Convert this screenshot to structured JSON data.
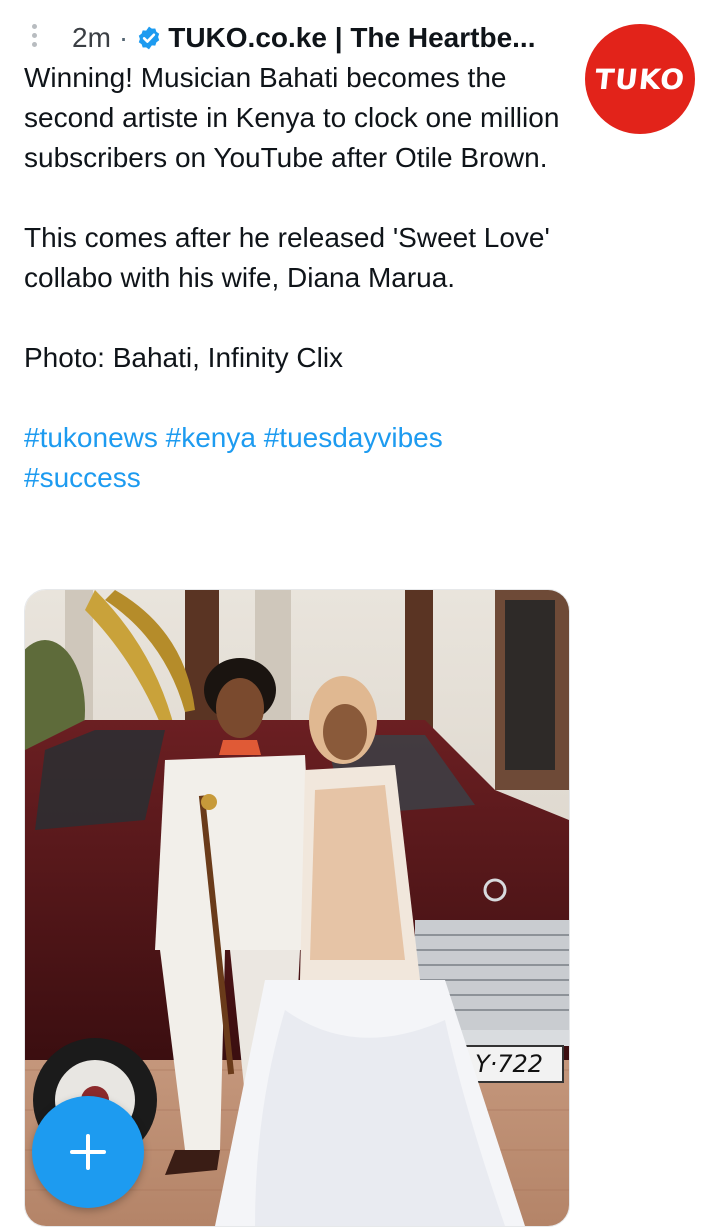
{
  "header": {
    "time": "2m",
    "separator": "·",
    "account_name": "TUKO.co.ke | The Heartbe...",
    "verified_icon": "verified-badge-icon",
    "avatar_text": "TUKO",
    "avatar_color": "#e2231a"
  },
  "tweet": {
    "paragraphs": [
      "Winning! Musician Bahati becomes the second artiste in Kenya to clock one million subscribers on YouTube after Otile Brown.",
      "This comes after he released 'Sweet Love' collabo with his wife, Diana Marua.",
      "Photo: Bahati, Infinity Clix"
    ],
    "hashtags": [
      "#tukonews",
      "#kenya",
      "#tuesdayvibes",
      "#success"
    ]
  },
  "media": {
    "plate_text": "Y·722"
  },
  "fab": {
    "icon": "plus-icon",
    "color": "#1d9bf0"
  },
  "colors": {
    "link": "#1d9bf0",
    "text": "#0f1419",
    "muted": "#536471"
  }
}
